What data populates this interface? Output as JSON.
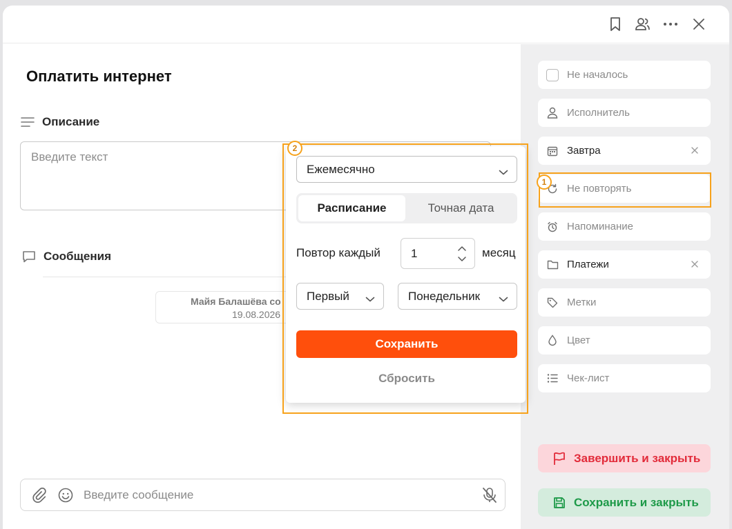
{
  "task": {
    "title": "Оплатить интернет",
    "description_label": "Описание",
    "description_placeholder": "Введите текст",
    "messages_label": "Сообщения",
    "message_author": "Майя Балашёва со",
    "message_date": "19.08.2026",
    "composer_placeholder": "Введите сообщение"
  },
  "sidebar": {
    "items": [
      {
        "label": "Не началось",
        "icon": "checkbox"
      },
      {
        "label": "Исполнитель",
        "icon": "user-icon"
      },
      {
        "label": "Завтра",
        "icon": "calendar-icon"
      },
      {
        "label": "Не повторять",
        "icon": "repeat-icon"
      },
      {
        "label": "Напоминание",
        "icon": "alarm-icon"
      },
      {
        "label": "Платежи",
        "icon": "folder-icon"
      },
      {
        "label": "Метки",
        "icon": "tag-icon"
      },
      {
        "label": "Цвет",
        "icon": "drop-icon"
      },
      {
        "label": "Чек-лист",
        "icon": "checklist-icon"
      }
    ],
    "finish_label": "Завершить и закрыть",
    "save_close_label": "Сохранить и закрыть"
  },
  "popup": {
    "frequency": "Ежемесячно",
    "tab_schedule": "Расписание",
    "tab_exact_date": "Точная дата",
    "repeat_label": "Повтор каждый",
    "repeat_value": "1",
    "repeat_unit": "месяц",
    "ordinal": "Первый",
    "weekday": "Понедельник",
    "save_label": "Сохранить",
    "reset_label": "Сбросить"
  },
  "annotations": {
    "badge1": "1",
    "badge2": "2",
    "highlight_color": "#f7a21b"
  },
  "colors": {
    "accent": "#ff4f0c",
    "finish_bg": "#fcd6db",
    "finish_text": "#e22b3a",
    "save_close_bg": "#d4ecdd",
    "save_close_text": "#1e9a49"
  }
}
